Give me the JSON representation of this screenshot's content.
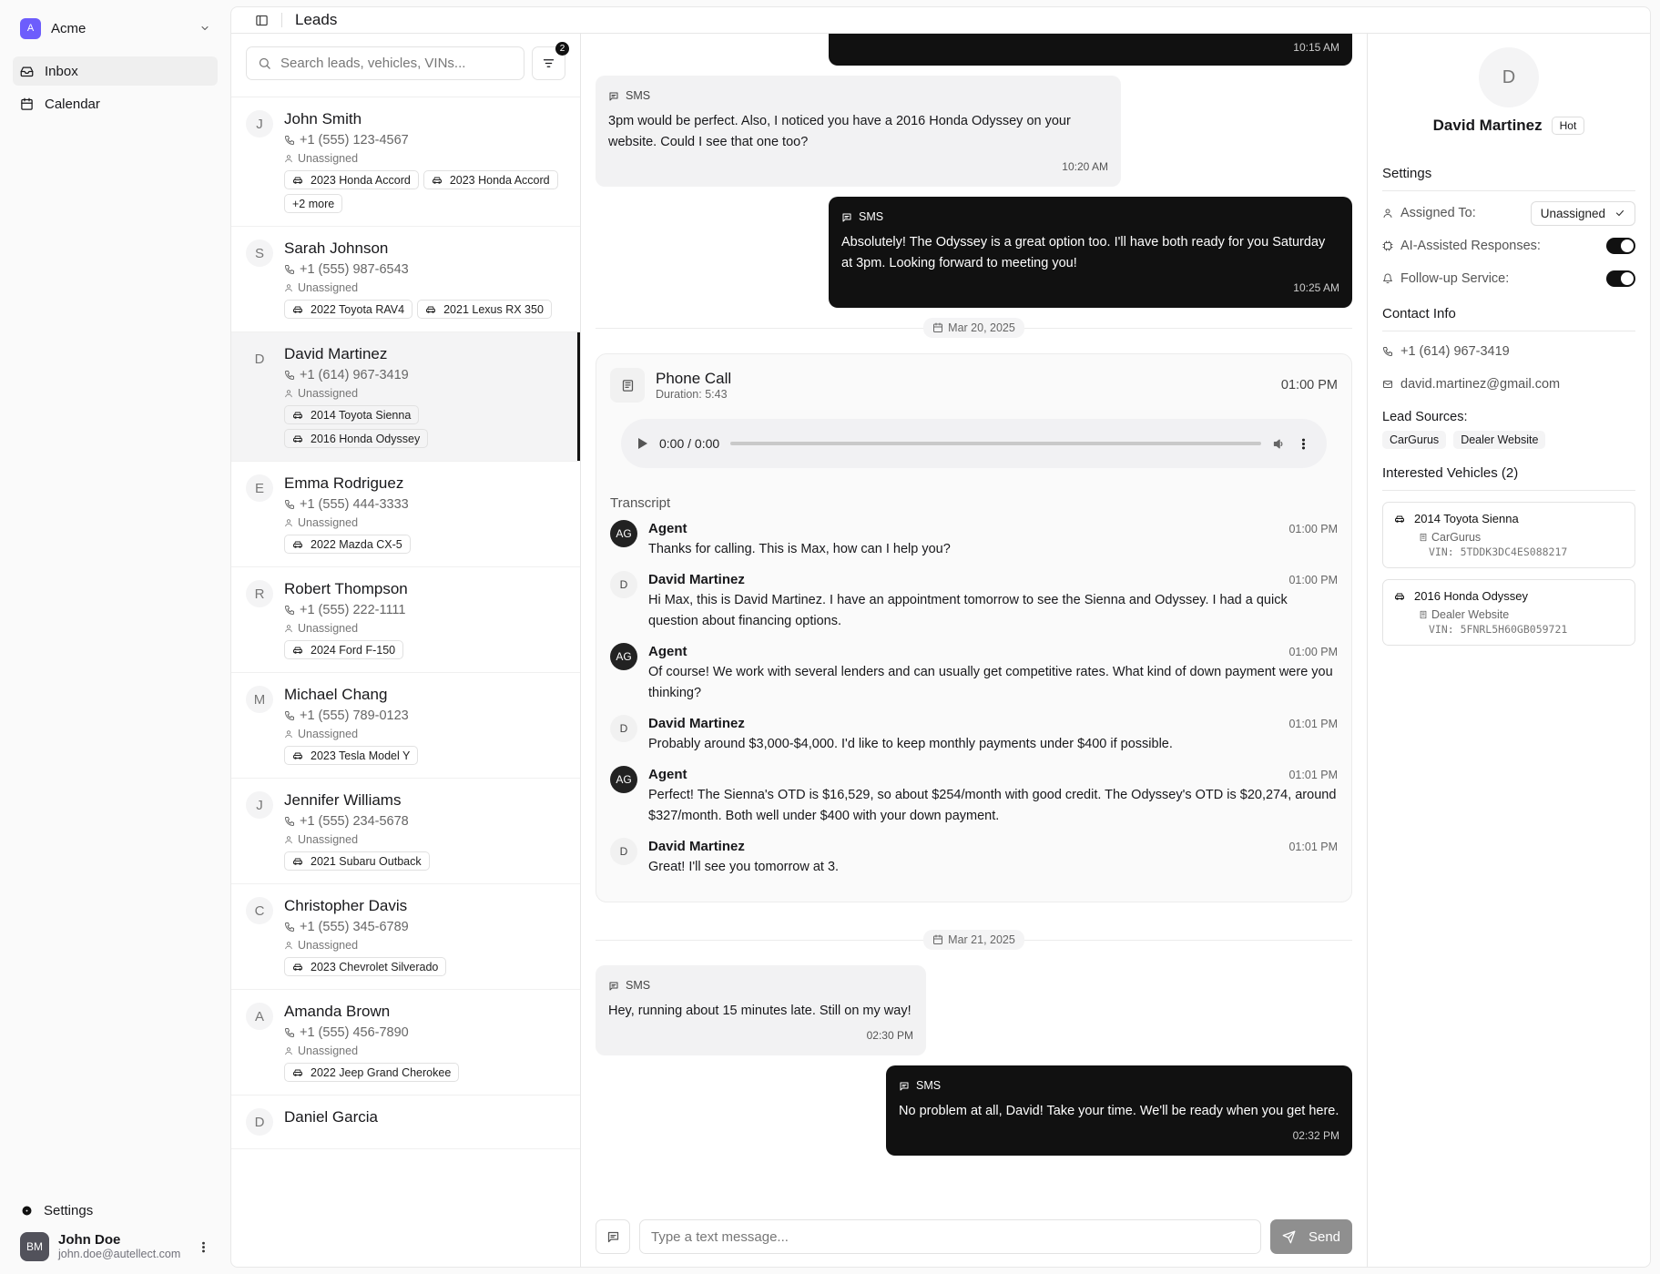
{
  "brand": {
    "logo_letter": "A",
    "name": "Acme",
    "logo_color": "#6d5dfc"
  },
  "nav": [
    {
      "label": "Inbox",
      "icon": "inbox-icon",
      "active": true
    },
    {
      "label": "Calendar",
      "icon": "calendar-icon",
      "active": false
    }
  ],
  "sidebar_footer": {
    "settings_label": "Settings",
    "user_initials": "BM",
    "user_name": "John Doe",
    "user_email": "john.doe@autellect.com"
  },
  "topbar": {
    "title": "Leads"
  },
  "search": {
    "placeholder": "Search leads, vehicles, VINs...",
    "filter_count": "2"
  },
  "leads": [
    {
      "initial": "J",
      "name": "John Smith",
      "phone": "+1 (555) 123-4567",
      "assigned": "Unassigned",
      "vehicles": [
        "2023 Honda Accord",
        "2023 Honda Accord"
      ],
      "more": "+2 more"
    },
    {
      "initial": "S",
      "name": "Sarah Johnson",
      "phone": "+1 (555) 987-6543",
      "assigned": "Unassigned",
      "vehicles": [
        "2022 Toyota RAV4",
        "2021 Lexus RX 350"
      ]
    },
    {
      "initial": "D",
      "name": "David Martinez",
      "phone": "+1 (614) 967-3419",
      "assigned": "Unassigned",
      "vehicles": [
        "2014 Toyota Sienna",
        "2016 Honda Odyssey"
      ],
      "active": true
    },
    {
      "initial": "E",
      "name": "Emma Rodriguez",
      "phone": "+1 (555) 444-3333",
      "assigned": "Unassigned",
      "vehicles": [
        "2022 Mazda CX-5"
      ]
    },
    {
      "initial": "R",
      "name": "Robert Thompson",
      "phone": "+1 (555) 222-1111",
      "assigned": "Unassigned",
      "vehicles": [
        "2024 Ford F-150"
      ]
    },
    {
      "initial": "M",
      "name": "Michael Chang",
      "phone": "+1 (555) 789-0123",
      "assigned": "Unassigned",
      "vehicles": [
        "2023 Tesla Model Y"
      ]
    },
    {
      "initial": "J",
      "name": "Jennifer Williams",
      "phone": "+1 (555) 234-5678",
      "assigned": "Unassigned",
      "vehicles": [
        "2021 Subaru Outback"
      ]
    },
    {
      "initial": "C",
      "name": "Christopher Davis",
      "phone": "+1 (555) 345-6789",
      "assigned": "Unassigned",
      "vehicles": [
        "2023 Chevrolet Silverado"
      ]
    },
    {
      "initial": "A",
      "name": "Amanda Brown",
      "phone": "+1 (555) 456-7890",
      "assigned": "Unassigned",
      "vehicles": [
        "2022 Jeep Grand Cherokee"
      ]
    },
    {
      "initial": "D",
      "name": "Daniel Garcia",
      "phone": "",
      "assigned": "",
      "vehicles": []
    }
  ],
  "chat": {
    "top_time": "10:15 AM",
    "sms1": {
      "label": "SMS",
      "text": "3pm would be perfect. Also, I noticed you have a 2016 Honda Odyssey on your website. Could I see that one too?",
      "time": "10:20 AM"
    },
    "sms2": {
      "label": "SMS",
      "text": "Absolutely! The Odyssey is a great option too. I'll have both ready for you Saturday at 3pm. Looking forward to meeting you!",
      "time": "10:25 AM"
    },
    "date1": "Mar 20, 2025",
    "call": {
      "title": "Phone Call",
      "duration": "Duration: 5:43",
      "time": "01:00 PM",
      "audio_time": "0:00 / 0:00",
      "transcript_label": "Transcript",
      "lines": [
        {
          "speaker": "Agent",
          "initials": "AG",
          "time": "01:00 PM",
          "text": "Thanks for calling. This is Max, how can I help you?"
        },
        {
          "speaker": "David Martinez",
          "initials": "D",
          "time": "01:00 PM",
          "text": "Hi Max, this is David Martinez. I have an appointment tomorrow to see the Sienna and Odyssey. I had a quick question about financing options."
        },
        {
          "speaker": "Agent",
          "initials": "AG",
          "time": "01:00 PM",
          "text": "Of course! We work with several lenders and can usually get competitive rates. What kind of down payment were you thinking?"
        },
        {
          "speaker": "David Martinez",
          "initials": "D",
          "time": "01:01 PM",
          "text": "Probably around $3,000-$4,000. I'd like to keep monthly payments under $400 if possible."
        },
        {
          "speaker": "Agent",
          "initials": "AG",
          "time": "01:01 PM",
          "text": "Perfect! The Sienna's OTD is $16,529, so about $254/month with good credit. The Odyssey's OTD is $20,274, around $327/month. Both well under $400 with your down payment."
        },
        {
          "speaker": "David Martinez",
          "initials": "D",
          "time": "01:01 PM",
          "text": "Great! I'll see you tomorrow at 3."
        }
      ]
    },
    "date2": "Mar 21, 2025",
    "sms3": {
      "label": "SMS",
      "text": "Hey, running about 15 minutes late. Still on my way!",
      "time": "02:30 PM"
    },
    "sms4": {
      "label": "SMS",
      "text": "No problem at all, David! Take your time. We'll be ready when you get here.",
      "time": "02:32 PM"
    },
    "composer": {
      "placeholder": "Type a text message...",
      "send_label": "Send"
    }
  },
  "details": {
    "initial": "D",
    "name": "David Martinez",
    "tag": "Hot",
    "settings_title": "Settings",
    "assigned_label": "Assigned To:",
    "assigned_value": "Unassigned",
    "ai_label": "AI-Assisted Responses:",
    "ai_on": true,
    "followup_label": "Follow-up Service:",
    "followup_on": true,
    "contact_title": "Contact Info",
    "phone": "+1 (614) 967-3419",
    "email": "david.martinez@gmail.com",
    "sources_label": "Lead Sources:",
    "sources": [
      "CarGurus",
      "Dealer Website"
    ],
    "vehicles_title": "Interested Vehicles (2)",
    "vehicles": [
      {
        "name": "2014 Toyota Sienna",
        "source": "CarGurus",
        "vin": "VIN: 5TDDK3DC4ES088217"
      },
      {
        "name": "2016 Honda Odyssey",
        "source": "Dealer Website",
        "vin": "VIN: 5FNRL5H60GB059721"
      }
    ]
  }
}
